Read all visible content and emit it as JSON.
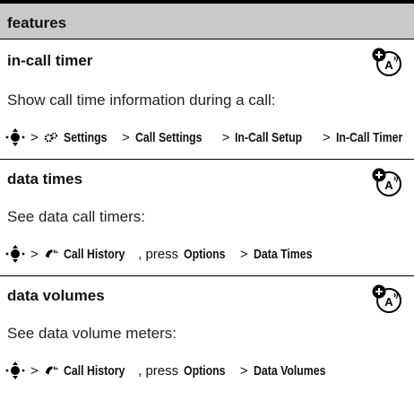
{
  "header": {
    "title": "features"
  },
  "sections": [
    {
      "title": "in-call timer",
      "description": "Show call time information during a call:",
      "path": {
        "gt1": ">",
        "item1": "Settings",
        "gt2": ">",
        "item2": "Call Settings",
        "gt3": ">",
        "item3": "In-Call Setup",
        "gt4": ">",
        "item4": "In-Call Timer"
      },
      "icons": {
        "nav": "nav-key-icon",
        "menu": "settings-icon",
        "badge": "network-feature-icon"
      }
    },
    {
      "title": "data times",
      "description": "See data call timers:",
      "path": {
        "gt1": ">",
        "item1": "Call History",
        "press": ", press",
        "item2": "Options",
        "gt2": ">",
        "item3": "Data Times"
      },
      "icons": {
        "nav": "nav-key-icon",
        "menu": "call-history-icon",
        "badge": "network-feature-icon"
      }
    },
    {
      "title": "data volumes",
      "description": "See data volume meters:",
      "path": {
        "gt1": ">",
        "item1": "Call History",
        "press": ", press",
        "item2": "Options",
        "gt2": ">",
        "item3": "Data Volumes"
      },
      "icons": {
        "nav": "nav-key-icon",
        "menu": "call-history-icon",
        "badge": "network-feature-icon"
      }
    }
  ]
}
